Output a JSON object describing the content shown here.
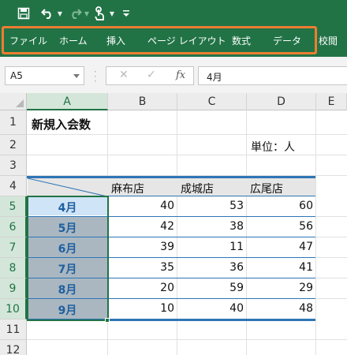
{
  "quick_access": {
    "save_icon": "save-icon",
    "undo_icon": "undo-icon",
    "redo_icon": "redo-icon",
    "touch_icon": "touch-mode-icon",
    "customize_icon": "customize-qat-icon"
  },
  "ribbon": {
    "tabs": [
      "ファイル",
      "ホーム",
      "挿入",
      "ページ レイアウト",
      "数式",
      "データ",
      "校閲"
    ],
    "highlight_color": "#ed7d31",
    "theme_color": "#217346"
  },
  "formula_bar": {
    "name_box": "A5",
    "fx_label": "fx",
    "cancel_symbol": "✕",
    "enter_symbol": "✓",
    "content": "4月"
  },
  "sheet": {
    "columns": [
      "A",
      "B",
      "C",
      "D",
      "E"
    ],
    "rows": [
      "1",
      "2",
      "3",
      "4",
      "5",
      "6",
      "7",
      "8",
      "9",
      "10",
      "11",
      "12"
    ],
    "title": "新規入会数",
    "unit": "単位：人",
    "headers": [
      "麻布店",
      "成城店",
      "広尾店"
    ],
    "data": [
      {
        "month": "4月",
        "values": [
          40,
          53,
          60
        ]
      },
      {
        "month": "5月",
        "values": [
          42,
          38,
          56
        ]
      },
      {
        "month": "6月",
        "values": [
          39,
          11,
          47
        ]
      },
      {
        "month": "7月",
        "values": [
          35,
          36,
          41
        ]
      },
      {
        "month": "8月",
        "values": [
          20,
          59,
          29
        ]
      },
      {
        "month": "9月",
        "values": [
          10,
          40,
          48
        ]
      }
    ],
    "selected_range": "A5:A10",
    "active_cell": "A5"
  }
}
